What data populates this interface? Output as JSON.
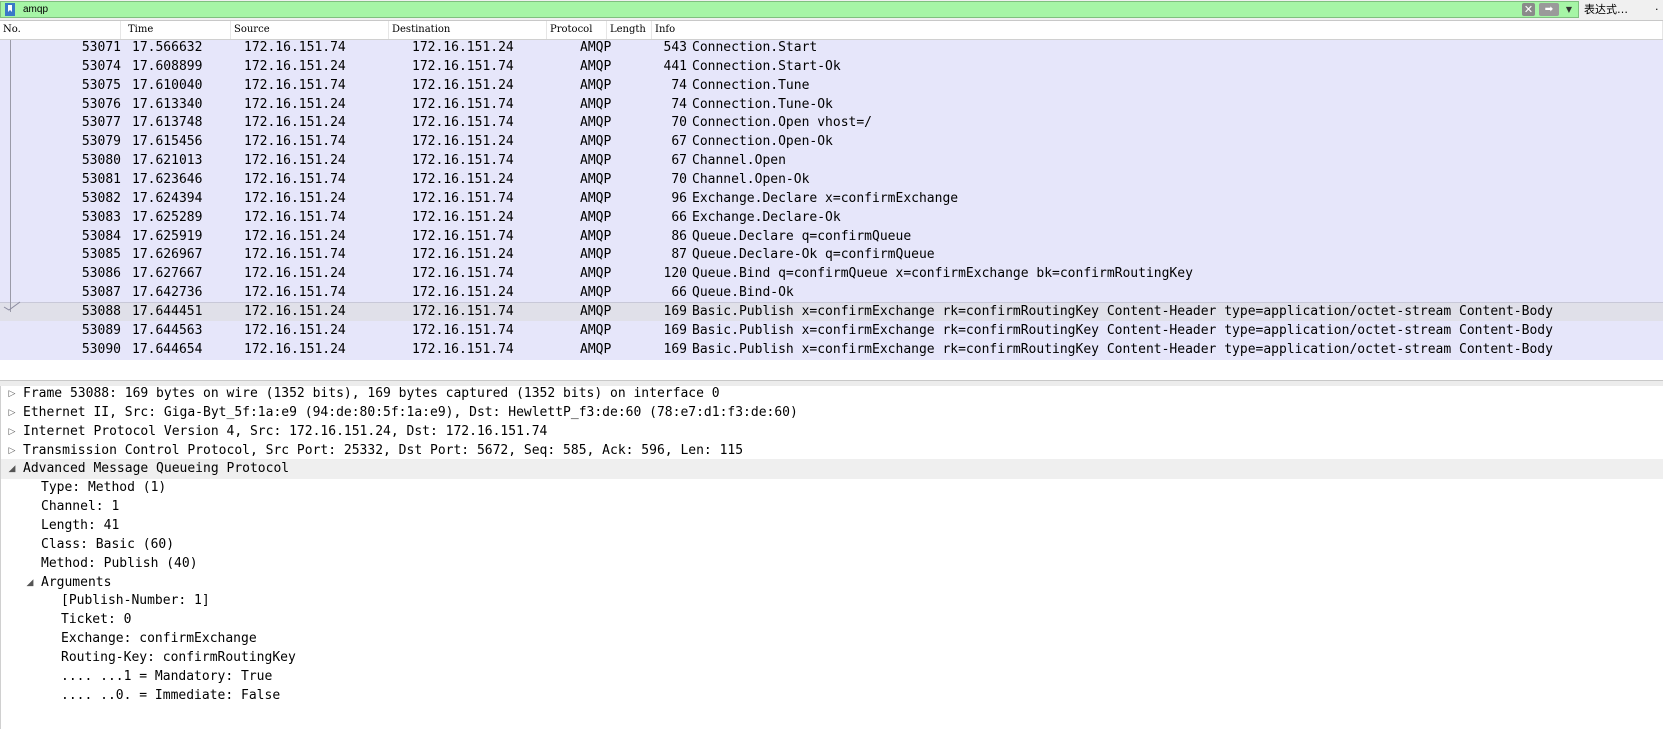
{
  "filter": {
    "value": "amqp",
    "expression_label": "表达式…",
    "clear_glyph": "✕",
    "apply_glyph": "➡",
    "dropdown_glyph": "▼",
    "extra_glyph": "·"
  },
  "columns": [
    "No.",
    "Time",
    "Source",
    "Destination",
    "Protocol",
    "Length",
    "Info"
  ],
  "colors": {
    "filter_valid": "#a6f5a6",
    "row_amqp": "#e6e6fa",
    "row_selected": "#e0e0e9"
  },
  "packets": [
    {
      "no": "53071",
      "time": "17.566632",
      "src": "172.16.151.74",
      "dst": "172.16.151.24",
      "proto": "AMQP",
      "len": "543",
      "info": "Connection.Start"
    },
    {
      "no": "53074",
      "time": "17.608899",
      "src": "172.16.151.24",
      "dst": "172.16.151.74",
      "proto": "AMQP",
      "len": "441",
      "info": "Connection.Start-Ok"
    },
    {
      "no": "53075",
      "time": "17.610040",
      "src": "172.16.151.74",
      "dst": "172.16.151.24",
      "proto": "AMQP",
      "len": "74",
      "info": "Connection.Tune"
    },
    {
      "no": "53076",
      "time": "17.613340",
      "src": "172.16.151.24",
      "dst": "172.16.151.74",
      "proto": "AMQP",
      "len": "74",
      "info": "Connection.Tune-Ok"
    },
    {
      "no": "53077",
      "time": "17.613748",
      "src": "172.16.151.24",
      "dst": "172.16.151.74",
      "proto": "AMQP",
      "len": "70",
      "info": "Connection.Open vhost=/"
    },
    {
      "no": "53079",
      "time": "17.615456",
      "src": "172.16.151.74",
      "dst": "172.16.151.24",
      "proto": "AMQP",
      "len": "67",
      "info": "Connection.Open-Ok"
    },
    {
      "no": "53080",
      "time": "17.621013",
      "src": "172.16.151.24",
      "dst": "172.16.151.74",
      "proto": "AMQP",
      "len": "67",
      "info": "Channel.Open"
    },
    {
      "no": "53081",
      "time": "17.623646",
      "src": "172.16.151.74",
      "dst": "172.16.151.24",
      "proto": "AMQP",
      "len": "70",
      "info": "Channel.Open-Ok"
    },
    {
      "no": "53082",
      "time": "17.624394",
      "src": "172.16.151.24",
      "dst": "172.16.151.74",
      "proto": "AMQP",
      "len": "96",
      "info": "Exchange.Declare x=confirmExchange"
    },
    {
      "no": "53083",
      "time": "17.625289",
      "src": "172.16.151.74",
      "dst": "172.16.151.24",
      "proto": "AMQP",
      "len": "66",
      "info": "Exchange.Declare-Ok"
    },
    {
      "no": "53084",
      "time": "17.625919",
      "src": "172.16.151.24",
      "dst": "172.16.151.74",
      "proto": "AMQP",
      "len": "86",
      "info": "Queue.Declare q=confirmQueue"
    },
    {
      "no": "53085",
      "time": "17.626967",
      "src": "172.16.151.74",
      "dst": "172.16.151.24",
      "proto": "AMQP",
      "len": "87",
      "info": "Queue.Declare-Ok q=confirmQueue"
    },
    {
      "no": "53086",
      "time": "17.627667",
      "src": "172.16.151.24",
      "dst": "172.16.151.74",
      "proto": "AMQP",
      "len": "120",
      "info": "Queue.Bind q=confirmQueue x=confirmExchange bk=confirmRoutingKey"
    },
    {
      "no": "53087",
      "time": "17.642736",
      "src": "172.16.151.74",
      "dst": "172.16.151.24",
      "proto": "AMQP",
      "len": "66",
      "info": "Queue.Bind-Ok"
    },
    {
      "no": "53088",
      "time": "17.644451",
      "src": "172.16.151.24",
      "dst": "172.16.151.74",
      "proto": "AMQP",
      "len": "169",
      "info": "Basic.Publish x=confirmExchange rk=confirmRoutingKey Content-Header type=application/octet-stream Content-Body",
      "selected": true
    },
    {
      "no": "53089",
      "time": "17.644563",
      "src": "172.16.151.24",
      "dst": "172.16.151.74",
      "proto": "AMQP",
      "len": "169",
      "info": "Basic.Publish x=confirmExchange rk=confirmRoutingKey Content-Header type=application/octet-stream Content-Body"
    },
    {
      "no": "53090",
      "time": "17.644654",
      "src": "172.16.151.24",
      "dst": "172.16.151.74",
      "proto": "AMQP",
      "len": "169",
      "info": "Basic.Publish x=confirmExchange rk=confirmRoutingKey Content-Header type=application/octet-stream Content-Body"
    }
  ],
  "details": [
    {
      "level": 0,
      "state": "collapsed",
      "text": "Frame 53088: 169 bytes on wire (1352 bits), 169 bytes captured (1352 bits) on interface 0"
    },
    {
      "level": 0,
      "state": "collapsed",
      "text": "Ethernet II, Src: Giga-Byt_5f:1a:e9 (94:de:80:5f:1a:e9), Dst: HewlettP_f3:de:60 (78:e7:d1:f3:de:60)"
    },
    {
      "level": 0,
      "state": "collapsed",
      "text": "Internet Protocol Version 4, Src: 172.16.151.24, Dst: 172.16.151.74"
    },
    {
      "level": 0,
      "state": "collapsed",
      "text": "Transmission Control Protocol, Src Port: 25332, Dst Port: 5672, Seq: 585, Ack: 596, Len: 115"
    },
    {
      "level": 0,
      "state": "expanded",
      "text": "Advanced Message Queueing Protocol"
    },
    {
      "level": 1,
      "state": "leaf",
      "text": "Type: Method (1)"
    },
    {
      "level": 1,
      "state": "leaf",
      "text": "Channel: 1"
    },
    {
      "level": 1,
      "state": "leaf",
      "text": "Length: 41"
    },
    {
      "level": 1,
      "state": "leaf",
      "text": "Class: Basic (60)"
    },
    {
      "level": 1,
      "state": "leaf",
      "text": "Method: Publish (40)"
    },
    {
      "level": 1,
      "state": "expanded-sub",
      "text": "Arguments"
    },
    {
      "level": 2,
      "state": "leaf",
      "text": "[Publish-Number: 1]"
    },
    {
      "level": 2,
      "state": "leaf",
      "text": "Ticket: 0"
    },
    {
      "level": 2,
      "state": "leaf",
      "text": "Exchange: confirmExchange"
    },
    {
      "level": 2,
      "state": "leaf",
      "text": "Routing-Key: confirmRoutingKey"
    },
    {
      "level": 2,
      "state": "leaf",
      "text": ".... ...1 = Mandatory: True"
    },
    {
      "level": 2,
      "state": "leaf",
      "text": ".... ..0. = Immediate: False"
    }
  ]
}
